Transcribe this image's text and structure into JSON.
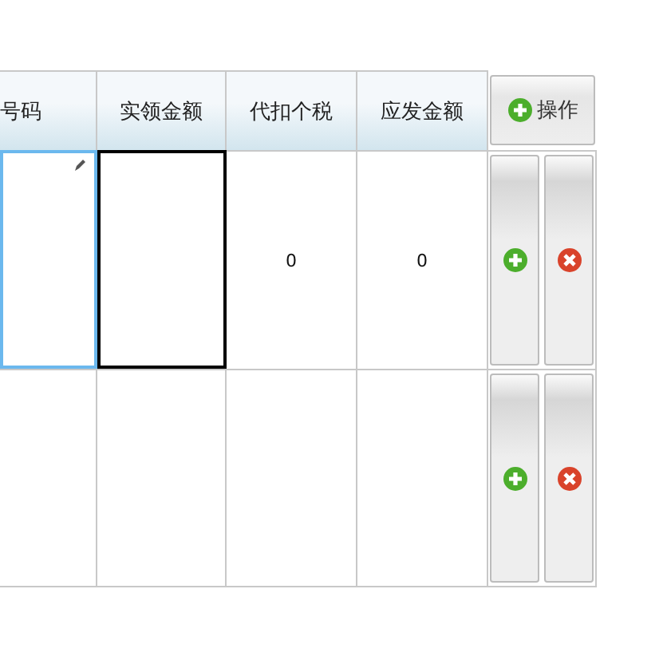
{
  "columns": [
    {
      "label": "号码"
    },
    {
      "label": "实领金额"
    },
    {
      "label": "代扣个税"
    },
    {
      "label": "应发金额"
    }
  ],
  "action_header": {
    "label": "操作"
  },
  "rows": [
    {
      "cells": [
        {
          "editing": true,
          "selected": false
        },
        {
          "editing": false,
          "selected": true
        },
        {
          "value": "0",
          "editing": false,
          "selected": false
        },
        {
          "value": "0",
          "editing": false,
          "selected": false
        }
      ]
    },
    {
      "cells": [
        {
          "editing": false,
          "selected": false
        },
        {
          "editing": false,
          "selected": false
        },
        {
          "editing": false,
          "selected": false
        },
        {
          "editing": false,
          "selected": false
        }
      ]
    }
  ]
}
